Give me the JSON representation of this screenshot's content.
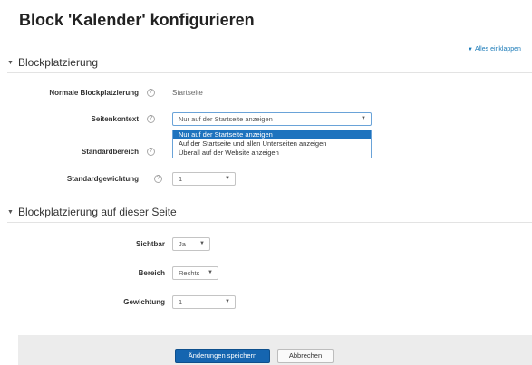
{
  "page": {
    "title": "Block 'Kalender' konfigurieren"
  },
  "collapse_all": {
    "label": "Alles einklappen"
  },
  "section1": {
    "title": "Blockplatzierung",
    "fields": {
      "normal_placement": {
        "label": "Normale Blockplatzierung",
        "value": "Startseite"
      },
      "page_context": {
        "label": "Seitenkontext",
        "value": "Nur auf der Startseite anzeigen",
        "options": [
          "Nur auf der Startseite anzeigen",
          "Auf der Startseite und allen Unterseiten anzeigen",
          "Überall auf der Website anzeigen"
        ]
      },
      "default_region": {
        "label": "Standardbereich"
      },
      "default_weight": {
        "label": "Standardgewichtung",
        "value": "1"
      }
    }
  },
  "section2": {
    "title": "Blockplatzierung auf dieser Seite",
    "fields": {
      "visible": {
        "label": "Sichtbar",
        "value": "Ja"
      },
      "region": {
        "label": "Bereich",
        "value": "Rechts"
      },
      "weight": {
        "label": "Gewichtung",
        "value": "1"
      }
    }
  },
  "footer": {
    "save_label": "Änderungen speichern",
    "cancel_label": "Abbrechen"
  },
  "colors": {
    "link": "#1a7ab8",
    "primary": "#1565b0",
    "highlight": "#1e73be",
    "focus_border": "#6aa3d8"
  },
  "icons": {
    "help": "question-circle-icon",
    "expand": "chevron-down-icon",
    "select_arrow": "caret-down-icon"
  }
}
